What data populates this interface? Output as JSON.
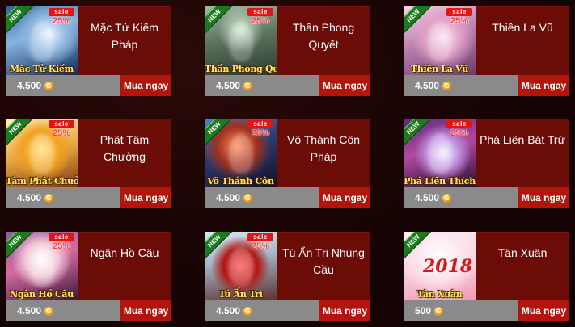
{
  "currency_icon_glyph": "G",
  "buy_label": "Mua ngay",
  "sale_label": "sale",
  "new_label": "NEW",
  "colors": {
    "card_bg": "#6b0c07",
    "price_bar": "#8a8a8a",
    "buy_button": "#b3150c",
    "new_ribbon": "#1e7a1e",
    "sale_badge": "#e21515",
    "caption": "#ffe95a"
  },
  "products": [
    {
      "title": "Mặc Tử Kiếm Pháp",
      "caption": "Mặc Tử Kiếm",
      "price": "4.500",
      "discount": "25%",
      "is_new": true,
      "on_sale": true
    },
    {
      "title": "Thần Phong Quyết",
      "caption": "Thần Phong Quyết",
      "price": "4.500",
      "discount": "25%",
      "is_new": true,
      "on_sale": true
    },
    {
      "title": "Thiên La Vũ",
      "caption": "Thiên La Vũ",
      "price": "4.500",
      "discount": "25%",
      "is_new": true,
      "on_sale": true
    },
    {
      "title": "Phật Tâm Chưởng",
      "caption": "Tâm Phật Chưởng",
      "price": "4.500",
      "discount": "25%",
      "is_new": true,
      "on_sale": true
    },
    {
      "title": "Võ Thánh Côn Pháp",
      "caption": "Võ Thánh Côn",
      "price": "4.500",
      "discount": "25%",
      "is_new": true,
      "on_sale": true
    },
    {
      "title": "Phá Liên Bát Trứ",
      "caption": "Phá Liên Thích",
      "price": "4.500",
      "discount": "25%",
      "is_new": true,
      "on_sale": true
    },
    {
      "title": "Ngân Hồ Câu",
      "caption": "Ngân Hồ Câu",
      "price": "4.500",
      "discount": "25%",
      "is_new": true,
      "on_sale": true
    },
    {
      "title": "Tú Ẩn Tri Nhung Cầu",
      "caption": "Tú Ẩn Tri",
      "price": "4.500",
      "discount": "25%",
      "is_new": true,
      "on_sale": true
    },
    {
      "title": "Tân Xuân",
      "caption": "Tân Xuân",
      "price": "500",
      "discount": "",
      "is_new": true,
      "on_sale": false,
      "art_text": "2018"
    }
  ]
}
